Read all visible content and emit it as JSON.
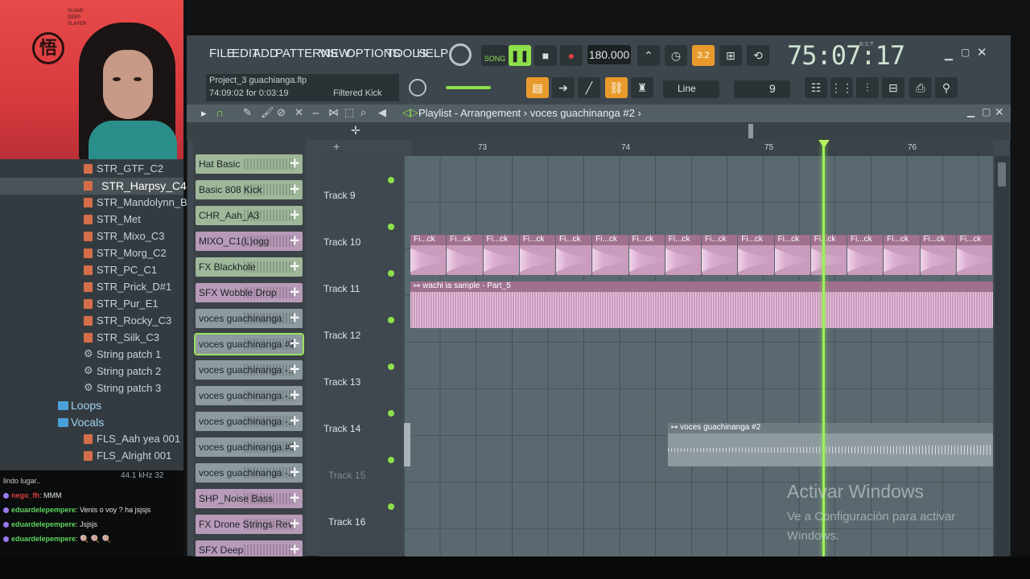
{
  "webcam": {
    "logo_glyph": "悟",
    "poster_lines": [
      "SUAVE",
      "DEEP",
      "SLAYER"
    ]
  },
  "browser": {
    "items": [
      {
        "label": "STR_GTF_C2",
        "icon": "plugin-preset-icon",
        "indent": 1
      },
      {
        "label": "STR_Harpsy_C4",
        "icon": "plugin-preset-icon",
        "indent": 1,
        "selected": true
      },
      {
        "label": "STR_Mandolynn_B2",
        "icon": "plugin-preset-icon",
        "indent": 1
      },
      {
        "label": "STR_Met",
        "icon": "plugin-preset-icon",
        "indent": 1
      },
      {
        "label": "STR_Mixo_C3",
        "icon": "plugin-preset-icon",
        "indent": 1
      },
      {
        "label": "STR_Morg_C2",
        "icon": "plugin-preset-icon",
        "indent": 1
      },
      {
        "label": "STR_PC_C1",
        "icon": "plugin-preset-icon",
        "indent": 1
      },
      {
        "label": "STR_Prick_D#1",
        "icon": "plugin-preset-icon",
        "indent": 1
      },
      {
        "label": "STR_Pur_E1",
        "icon": "plugin-preset-icon",
        "indent": 1
      },
      {
        "label": "STR_Rocky_C3",
        "icon": "plugin-preset-icon",
        "indent": 1
      },
      {
        "label": "STR_Silk_C3",
        "icon": "plugin-preset-icon",
        "indent": 1
      },
      {
        "label": "String patch 1",
        "icon": "gear-icon",
        "indent": 1
      },
      {
        "label": "String patch 2",
        "icon": "gear-icon",
        "indent": 1
      },
      {
        "label": "String patch 3",
        "icon": "gear-icon",
        "indent": 1
      },
      {
        "label": "Loops",
        "icon": "folder-icon",
        "indent": 0
      },
      {
        "label": "Vocals",
        "icon": "folder-icon",
        "indent": 0
      },
      {
        "label": "FLS_Aah yea 001",
        "icon": "plugin-preset-icon",
        "indent": 1
      },
      {
        "label": "FLS_Alright 001",
        "icon": "plugin-preset-icon",
        "indent": 1
      }
    ],
    "sample_rate": "44.1 kHz 32"
  },
  "chat": {
    "messages": [
      {
        "user": "",
        "text": "lindo lugar.."
      },
      {
        "user": "nego_fh",
        "text": "MMM"
      },
      {
        "user": "eduardelepempere",
        "text": "Venis o voy ? ha jsjsjs"
      },
      {
        "user": "eduardelepempere",
        "text": "Jsjsjs"
      },
      {
        "user": "eduardelepempere",
        "text": "🍭 🍭 🍭"
      }
    ]
  },
  "toolbar": {
    "menus": [
      "FILE",
      "EDIT",
      "ADD",
      "PATTERNS",
      "VIEW",
      "OPTIONS",
      "TOOLS",
      "HELP"
    ],
    "pat_song_label": "SONG",
    "tempo": "180.000",
    "time": "75:07:17",
    "time_unit": "B:S:T",
    "project_name": "Project_3 guachianga.flp",
    "project_time": "74:09:02 for 0:03:19",
    "channel_hint": "Filtered Kick",
    "snap_mode": "Line",
    "pattern_number": "9",
    "cpu_label": "3.2"
  },
  "playlist": {
    "title": "Playlist - Arrangement",
    "current_pattern": "voces guachinanga #2",
    "ruler_bars": [
      "73",
      "74",
      "75",
      "76"
    ],
    "patterns": [
      {
        "label": "Hat Basic",
        "color": "green"
      },
      {
        "label": "Basic 808 Kick",
        "color": "green"
      },
      {
        "label": "CHR_Aah_A3",
        "color": "green"
      },
      {
        "label": "MIXO_C1(L)ogg",
        "color": "purple"
      },
      {
        "label": "FX Blackhole",
        "color": "green"
      },
      {
        "label": "SFX Wobble Drop",
        "color": "purple"
      },
      {
        "label": "voces guachinanga",
        "color": "grey"
      },
      {
        "label": "voces guachinanga #2",
        "color": "grey",
        "selected": true
      },
      {
        "label": "voces guachinanga -...",
        "color": "grey"
      },
      {
        "label": "voces guachinanga -...",
        "color": "grey"
      },
      {
        "label": "voces guachinanga -...",
        "color": "grey"
      },
      {
        "label": "voces guachinanga #3",
        "color": "grey"
      },
      {
        "label": "voces guachinanga -...",
        "color": "grey"
      },
      {
        "label": "SHP_Noise Bass",
        "color": "purple"
      },
      {
        "label": "FX Drone Strings Rev",
        "color": "purple"
      },
      {
        "label": "SFX Deep",
        "color": "purple"
      }
    ],
    "tracks": [
      {
        "label": "Track 9"
      },
      {
        "label": "Track 10"
      },
      {
        "label": "Track 11"
      },
      {
        "label": "Track 12"
      },
      {
        "label": "Track 13"
      },
      {
        "label": "Track 14"
      },
      {
        "label": "Track 15",
        "dim": true
      },
      {
        "label": "Track 16"
      }
    ],
    "clips": {
      "track10_label": "Fi...ck",
      "track11_label": "wachi ia sample - Part_5",
      "track14_label": "voces guachinanga #2"
    }
  },
  "activate_windows": {
    "title": "Activar Windows",
    "line1": "Ve a Configuración para activar",
    "line2": "Windows."
  },
  "colors": {
    "playhead": "#9cf25a",
    "accent": "#e89b2c",
    "clip_pink": "#c99bbd",
    "clip_grey": "#8f9aa0"
  }
}
